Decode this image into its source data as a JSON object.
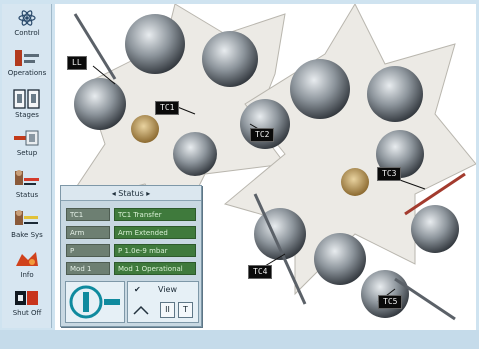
{
  "sidebar": {
    "items": [
      {
        "icon": "atom-icon",
        "label": "Control"
      },
      {
        "icon": "wrench-icon",
        "label": "Operations"
      },
      {
        "icon": "valves-icon",
        "label": "Stages"
      },
      {
        "icon": "pump-icon",
        "label": "Setup"
      },
      {
        "icon": "gauge-icon",
        "label": "Status"
      },
      {
        "icon": "heater-icon",
        "label": "Bake Sys"
      },
      {
        "icon": "sample-icon",
        "label": "Info"
      },
      {
        "icon": "exit-icon",
        "label": "Shut Off"
      }
    ]
  },
  "machine": {
    "tags": [
      "LL",
      "TC1",
      "TC2",
      "TC3",
      "TC4",
      "TC5"
    ]
  },
  "panel": {
    "title": "◂ Status ▸",
    "rows": [
      {
        "name": "TC1",
        "value": "TC1 Transfer"
      },
      {
        "name": "Arm",
        "value": "Arm Extended"
      },
      {
        "name": "P",
        "value": "P 1.0e-9 mbar"
      },
      {
        "name": "Mod 1",
        "value": "Mod 1 Operational"
      }
    ],
    "controls": {
      "check_label": "✔",
      "view_label": "View",
      "pause_label": "II",
      "stop_label": "T"
    }
  },
  "colors": {
    "background": "#cfe3f0",
    "tag_bg": "#0a0a0a",
    "row_value_bg": "#3f7a3c"
  }
}
